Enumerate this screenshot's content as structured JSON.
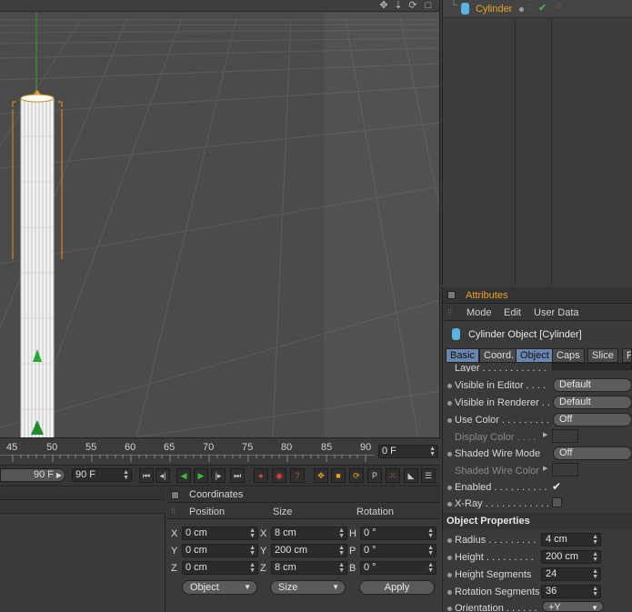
{
  "viewport": {
    "icons": [
      "move-view-icon",
      "zoom-view-icon",
      "rotate-view-icon",
      "maximize-view-icon"
    ]
  },
  "timeline": {
    "ticks": [
      "45",
      "50",
      "55",
      "60",
      "65",
      "70",
      "75",
      "80",
      "85",
      "90"
    ],
    "current_frame": "0 F"
  },
  "transport": {
    "end_frame_left": "90 F",
    "end_frame_right": "90 F"
  },
  "coordinates": {
    "title": "Coordinates",
    "headers": {
      "position": "Position",
      "size": "Size",
      "rotation": "Rotation"
    },
    "rows": [
      {
        "axis": "X",
        "pos": "0 cm",
        "size_axis": "X",
        "size": "8 cm",
        "rot_axis": "H",
        "rot": "0 °"
      },
      {
        "axis": "Y",
        "pos": "0 cm",
        "size_axis": "Y",
        "size": "200 cm",
        "rot_axis": "P",
        "rot": "0 °"
      },
      {
        "axis": "Z",
        "pos": "0 cm",
        "size_axis": "Z",
        "size": "8 cm",
        "rot_axis": "B",
        "rot": "0 °"
      }
    ],
    "mode_select": "Object",
    "size_select": "Size",
    "apply_label": "Apply"
  },
  "object_manager": {
    "object_name": "Cylinder",
    "accent": "#f0a020"
  },
  "attributes": {
    "title": "Attributes",
    "menu": [
      "Mode",
      "Edit",
      "User Data"
    ],
    "object_title": "Cylinder Object [Cylinder]",
    "tabs": [
      "Basic",
      "Coord.",
      "Object",
      "Caps",
      "Slice",
      "P"
    ],
    "basic": {
      "layer_label": "Layer . . . . . . . . . . . .",
      "visible_editor_label": "Visible in Editor . . . .",
      "visible_editor_value": "Default",
      "visible_renderer_label": "Visible in Renderer . .",
      "visible_renderer_value": "Default",
      "use_color_label": "Use Color . . . . . . . . .",
      "use_color_value": "Off",
      "display_color_label": "Display Color . . . .",
      "shaded_wire_label": "Shaded Wire Mode",
      "shaded_wire_value": "Off",
      "shaded_wire_color_label": "Shaded Wire Color",
      "enabled_label": "Enabled . . . . . . . . . .",
      "enabled_check": "✔",
      "xray_label": "X-Ray . . . . . . . . . . . ."
    },
    "object_properties": {
      "title": "Object Properties",
      "radius_label": "Radius . . . . . . . . .",
      "radius": "4 cm",
      "height_label": "Height . . . . . . . . .",
      "height": "200 cm",
      "height_segments_label": "Height Segments",
      "height_segments": "24",
      "rotation_segments_label": "Rotation Segments",
      "rotation_segments": "36",
      "orientation_label": "Orientation . . . . . .",
      "orientation": "+Y"
    }
  }
}
